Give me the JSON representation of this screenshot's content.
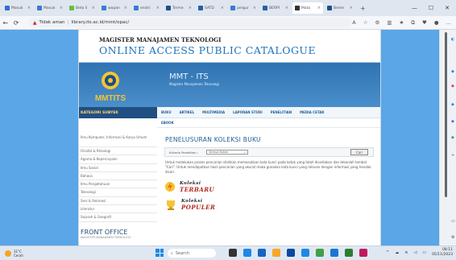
{
  "browser": {
    "tabs": [
      {
        "label": "Masuk",
        "color": "#2f6fd0"
      },
      {
        "label": "Masuk",
        "color": "#3a7bd5"
      },
      {
        "label": "Beta li",
        "color": "#6bbf3a"
      },
      {
        "label": "wapan",
        "color": "#3a7bd5"
      },
      {
        "label": "endni",
        "color": "#3a7bd5"
      },
      {
        "label": "Terme",
        "color": "#1f4d8a"
      },
      {
        "label": "SATD",
        "color": "#2a5fa5"
      },
      {
        "label": "pergur",
        "color": "#3a7bd5"
      },
      {
        "label": "BERPI",
        "color": "#2a5fa5"
      },
      {
        "label": "Mata",
        "color": "#333333",
        "active": true
      },
      {
        "label": "Beme",
        "color": "#1f4d8a"
      }
    ],
    "new_tab": "+",
    "security_label": "Tidak aman",
    "url": "library.its.ac.id/mmt/opac/"
  },
  "site": {
    "header_line1": "MAGISTER MANAJAMEN TEKNOLOGI",
    "header_line2": "ONLINE ACCESS PUBLIC CATALOGUE",
    "banner_title": "MMT - ITS",
    "banner_subtitle": "Magister Manajemen Teknologi",
    "logo_text": "MMTITS",
    "sidebar_header": "KATEGORI SUBYEK",
    "sidebar_items": [
      "Ilmu Komputer, Informasi & Karya Umum",
      "Filsafat & Psikologi",
      "Agama & Kepercayaan",
      "Ilmu Sosial",
      "Bahasa",
      "Ilmu Pengetahuan",
      "Teknologi",
      "Seni & Rekreasi",
      "Literatur",
      "Sejarah & Geografi"
    ],
    "front_office": "FRONT OFFICE",
    "front_office_sub": "MAGISTER MANAJEMEN TEKNOLOGI",
    "menu": [
      "BUKU",
      "ARTIKEL",
      "MULTIMEDIA",
      "LAPORAN STUDI",
      "PENELITIAN",
      "MEDIA CETAK"
    ],
    "menu_ebook": "EBOOK",
    "section_title": "PENELUSURAN KOLEKSI BUKU",
    "search_label": "Kriteria Penelitian :",
    "search_select": "Semua Kolom",
    "search_button": "Cari",
    "description": "Untuk melakukan proses pencarian silahkan memasukkan kata kunci pada kotak yang telah disediakan dan tekanlah tombol \"Cari\". Untuk mendapatkan hasil pencarian yang akurat maka gunakan kata kunci yang relevan dengan informasi yang hendak dicari.",
    "koleksi": [
      {
        "line1": "Koleksi",
        "line2": "TERBARU"
      },
      {
        "line1": "Koleksi",
        "line2": "POPULER"
      }
    ]
  },
  "taskbar": {
    "weather_temp": "31°C",
    "weather_desc": "Cerah",
    "search_placeholder": "Search",
    "time": "08:11",
    "date": "05/11/2023"
  }
}
